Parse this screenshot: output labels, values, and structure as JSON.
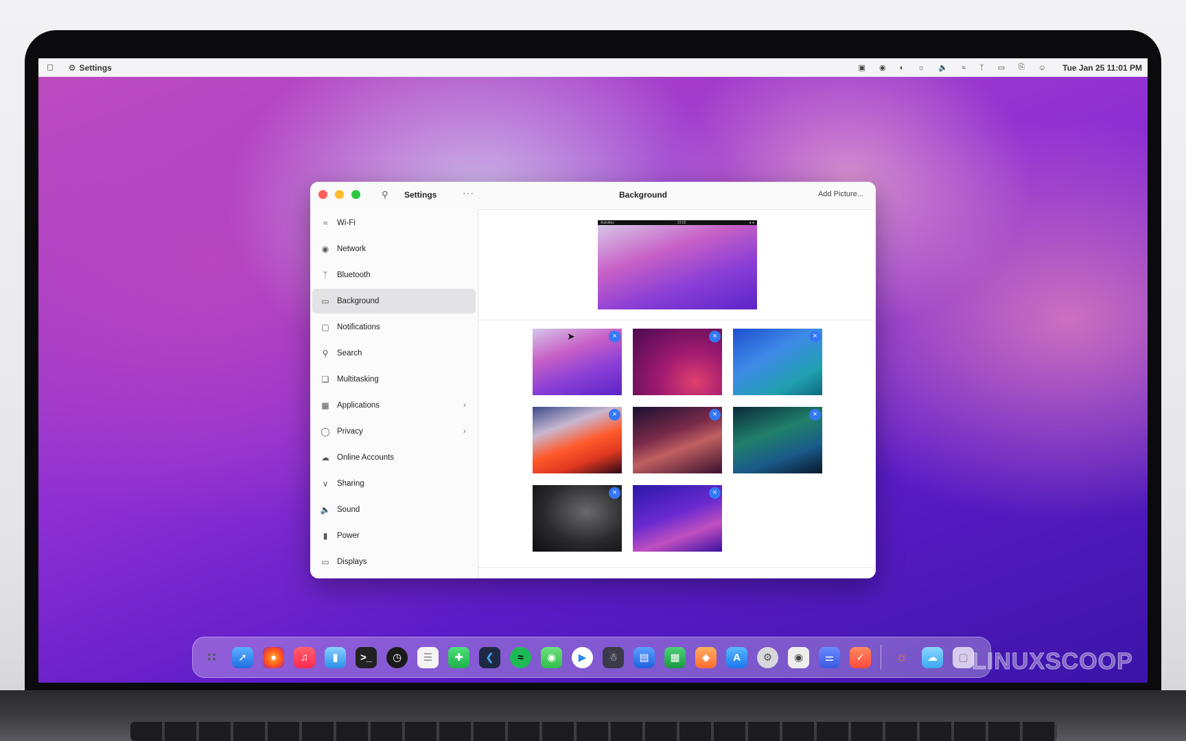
{
  "menubar": {
    "app_name": "Settings",
    "clock": "Tue Jan 25  11:01 PM"
  },
  "window": {
    "sidebar_title": "Settings",
    "more_glyph": "···",
    "title": "Background",
    "add_button": "Add Picture..."
  },
  "sidebar": {
    "items": [
      {
        "label": "Wi-Fi",
        "icon": "wifi-icon"
      },
      {
        "label": "Network",
        "icon": "globe-icon"
      },
      {
        "label": "Bluetooth",
        "icon": "bluetooth-icon"
      },
      {
        "label": "Background",
        "icon": "display-icon"
      },
      {
        "label": "Notifications",
        "icon": "bell-icon"
      },
      {
        "label": "Search",
        "icon": "search-icon"
      },
      {
        "label": "Multitasking",
        "icon": "multitasking-icon"
      },
      {
        "label": "Applications",
        "icon": "grid-icon"
      },
      {
        "label": "Privacy",
        "icon": "hand-icon"
      },
      {
        "label": "Online Accounts",
        "icon": "cloud-icon"
      },
      {
        "label": "Sharing",
        "icon": "share-icon"
      },
      {
        "label": "Sound",
        "icon": "speaker-icon"
      },
      {
        "label": "Power",
        "icon": "battery-icon"
      },
      {
        "label": "Displays",
        "icon": "monitor-icon"
      }
    ],
    "active": "Background"
  },
  "preview": {
    "bar_left": "Activities",
    "bar_center": "23:02"
  },
  "remove_glyph": "×",
  "watermark": "LINUXSCOOP"
}
